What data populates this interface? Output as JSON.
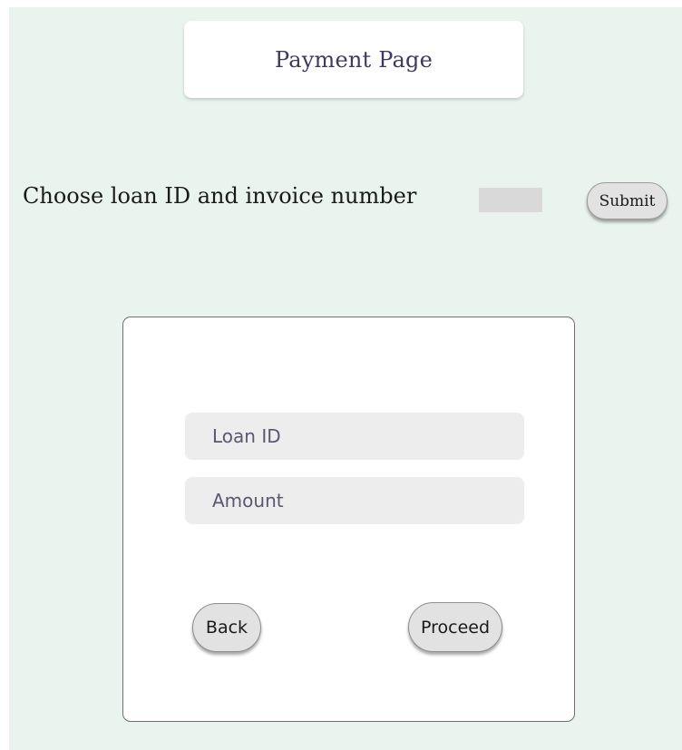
{
  "header": {
    "title": "Payment Page"
  },
  "selector": {
    "label": "Choose loan ID and invoice number",
    "value": "",
    "submit_label": "Submit"
  },
  "form": {
    "loan_id_placeholder": "Loan ID",
    "amount_placeholder": "Amount",
    "back_label": "Back",
    "proceed_label": "Proceed"
  },
  "colors": {
    "page_background": "#eaf4ee",
    "card_background": "#ffffff",
    "field_background": "#ededed",
    "button_background": "#e2e2e2",
    "title_text": "#3d3a5c"
  }
}
